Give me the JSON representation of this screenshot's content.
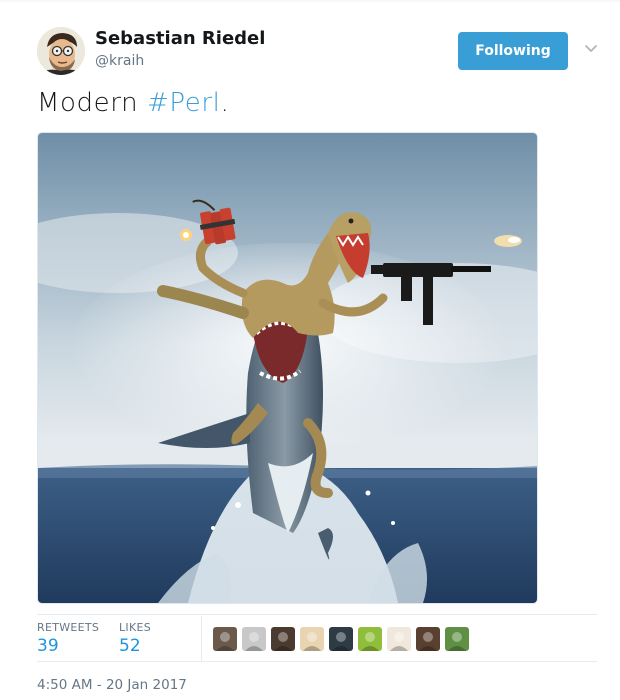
{
  "tweet": {
    "author": {
      "name": "Sebastian Riedel",
      "handle": "@kraih"
    },
    "follow_button_label": "Following",
    "text_prefix": "Modern ",
    "hashtag": "#Perl",
    "text_suffix": ".",
    "stats": {
      "retweets_label": "RETWEETS",
      "retweets_count": "39",
      "likes_label": "LIKES",
      "likes_count": "52"
    },
    "liker_avatar_colors": [
      "#6b5a4c",
      "#c8c8c8",
      "#4a3a30",
      "#e8d4b0",
      "#2e3a44",
      "#8fbf3a",
      "#f0e8dc",
      "#5a4030",
      "#5f8f45"
    ],
    "timestamp": "4:50 AM - 20 Jan 2017"
  },
  "colors": {
    "accent": "#3a9ed6",
    "link": "#1b95e0",
    "muted_text": "#657786"
  },
  "icons": {
    "menu": "chevron-down-icon"
  }
}
